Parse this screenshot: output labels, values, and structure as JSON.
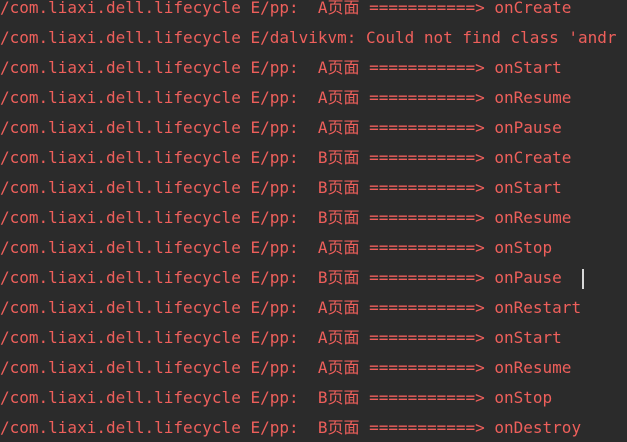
{
  "console": {
    "text_color": "#ee5f5b",
    "background_color": "#2b2b2b",
    "lines": [
      "/com.liaxi.dell.lifecycle E/pp:  A页面 ===========> onCreate",
      "/com.liaxi.dell.lifecycle E/dalvikvm: Could not find class 'andr",
      "/com.liaxi.dell.lifecycle E/pp:  A页面 ===========> onStart",
      "/com.liaxi.dell.lifecycle E/pp:  A页面 ===========> onResume",
      "/com.liaxi.dell.lifecycle E/pp:  A页面 ===========> onPause",
      "/com.liaxi.dell.lifecycle E/pp:  B页面 ===========> onCreate",
      "/com.liaxi.dell.lifecycle E/pp:  B页面 ===========> onStart",
      "/com.liaxi.dell.lifecycle E/pp:  B页面 ===========> onResume",
      "/com.liaxi.dell.lifecycle E/pp:  A页面 ===========> onStop",
      "/com.liaxi.dell.lifecycle E/pp:  B页面 ===========> onPause",
      "/com.liaxi.dell.lifecycle E/pp:  A页面 ===========> onRestart",
      "/com.liaxi.dell.lifecycle E/pp:  A页面 ===========> onStart",
      "/com.liaxi.dell.lifecycle E/pp:  A页面 ===========> onResume",
      "/com.liaxi.dell.lifecycle E/pp:  B页面 ===========> onStop",
      "/com.liaxi.dell.lifecycle E/pp:  B页面 ===========> onDestroy"
    ]
  }
}
